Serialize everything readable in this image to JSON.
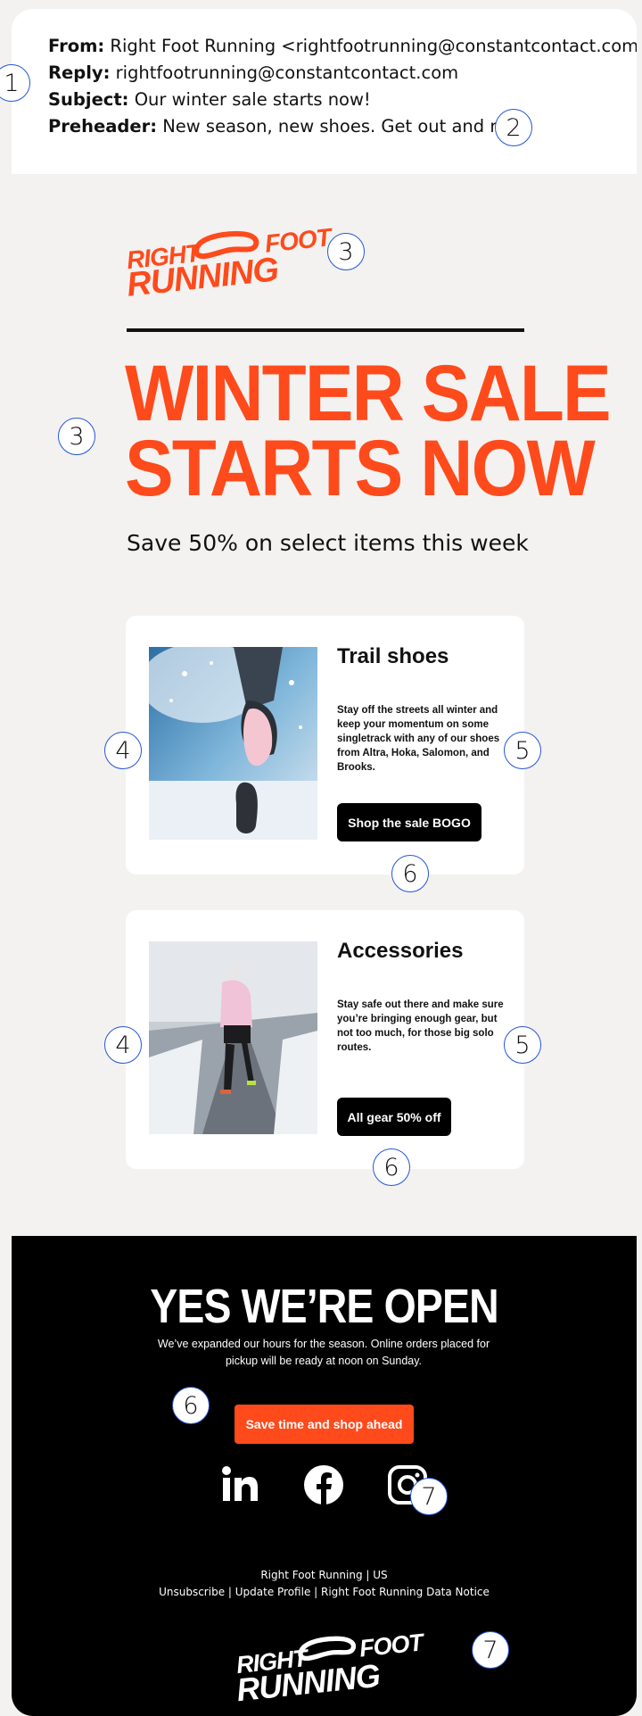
{
  "header": {
    "from_label": "From:",
    "from_value": "Right Foot Running <rightfootrunning@constantcontact.com>",
    "reply_label": "Reply:",
    "reply_value": "rightfootrunning@constantcontact.com",
    "subject_label": "Subject:",
    "subject_value": "Our winter sale starts now!",
    "preheader_label": "Preheader:",
    "preheader_value": "New season, new shoes. Get out and run!"
  },
  "brand": {
    "logo_left": "RIGHT",
    "logo_right": "FOOT",
    "logo_bottom": "RUNNING"
  },
  "hero": {
    "headline_line1": "WINTER SALE",
    "headline_line2": "STARTS NOW",
    "subline": "Save 50% on select items this week"
  },
  "cards": [
    {
      "title": "Trail shoes",
      "description": "Stay off the streets all winter and keep your momentum on some singletrack with any of our shoes from Altra, Hoka, Salomon, and Brooks.",
      "button": "Shop the sale BOGO"
    },
    {
      "title": "Accessories",
      "description": "Stay safe out there and make sure you’re bringing enough gear, but not too much, for those big solo routes.",
      "button": "All gear 50% off"
    }
  ],
  "footer": {
    "title": "YES WE’RE OPEN",
    "body": "We’ve expanded our hours for the season. Online orders placed for pickup will be ready at noon on Sunday.",
    "button": "Save time and shop ahead",
    "social": [
      "linkedin-icon",
      "facebook-icon",
      "instagram-icon"
    ],
    "address": "Right Foot Running | US",
    "links": "Unsubscribe | Update Profile | Right Foot Running Data Notice"
  },
  "callouts": [
    "1",
    "2",
    "3",
    "3",
    "4",
    "5",
    "6",
    "4",
    "5",
    "6",
    "6",
    "7",
    "7"
  ],
  "colors": {
    "accent": "#ff4a1c",
    "background": "#f3f2f0",
    "dark": "#000000",
    "callout_border": "#2456d6"
  }
}
